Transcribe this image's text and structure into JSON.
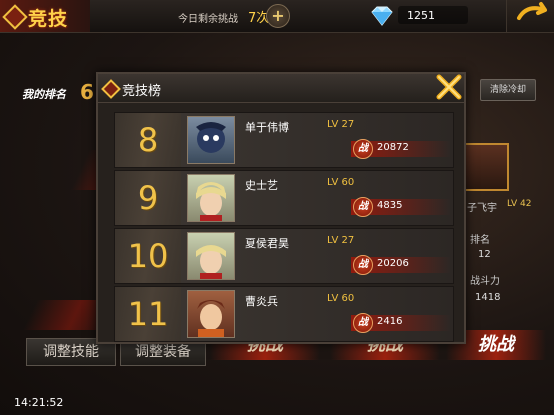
{
  "header": {
    "title": "竞技",
    "remain_label": "今日剩余挑战",
    "remain_count": "7次",
    "plus": "+",
    "gems": "1251"
  },
  "background": {
    "my_rank_label": "我的排名",
    "my_rank_value": "6",
    "clear_cooldown": "清除冷却",
    "side_player_name": "子飞宇",
    "side_player_lv": "LV 42",
    "side_rank_label": "排名",
    "side_rank_value": "12",
    "side_power_label": "战斗力",
    "side_power_value": "1418",
    "adjust_skill": "调整技能",
    "adjust_equip": "调整装备",
    "challenge_1": "挑战",
    "challenge_2": "挑战",
    "challenge_3": "挑战"
  },
  "panel": {
    "title": "竞技榜",
    "rows": [
      {
        "rank": "8",
        "name": "单于伟博",
        "lv": "LV 27",
        "power": "20872",
        "power_icon": "战"
      },
      {
        "rank": "9",
        "name": "史士艺",
        "lv": "LV 60",
        "power": "4835",
        "power_icon": "战"
      },
      {
        "rank": "10",
        "name": "夏侯君昊",
        "lv": "LV 27",
        "power": "20206",
        "power_icon": "战"
      },
      {
        "rank": "11",
        "name": "曹炎兵",
        "lv": "LV 60",
        "power": "2416",
        "power_icon": "战"
      }
    ]
  },
  "status": {
    "clock": "14:21:52"
  },
  "colors": {
    "accent_gold": "#f0c24a",
    "accent_red": "#961e0c"
  },
  "icons": [
    "diamond-icon",
    "gem-icon",
    "back-arrow-icon",
    "close-x-icon",
    "battle-power-icon"
  ]
}
